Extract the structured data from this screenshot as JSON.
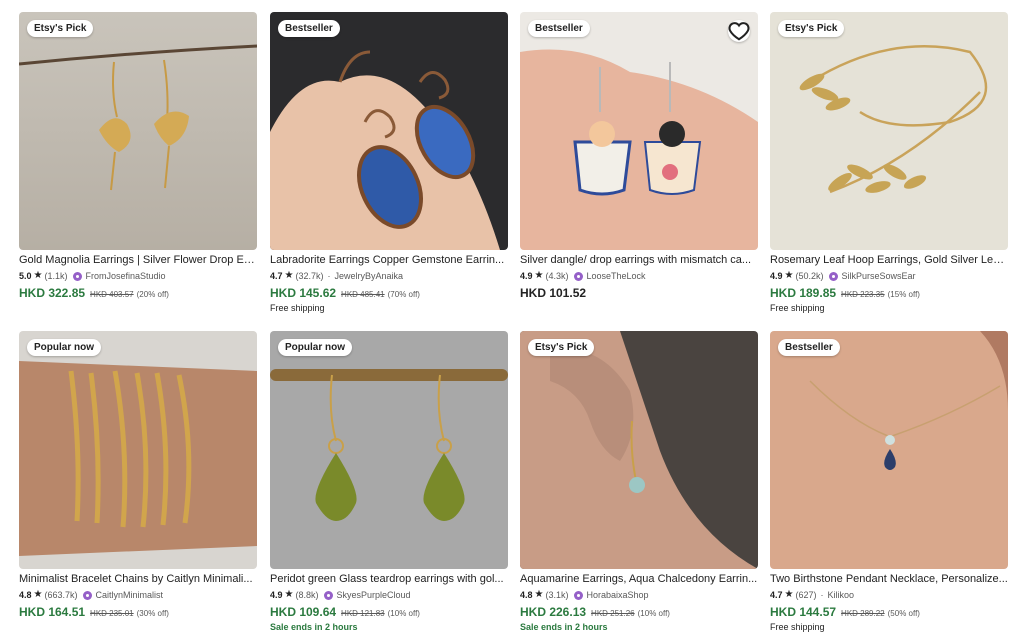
{
  "listings": [
    {
      "badge": "Etsy's Pick",
      "title": "Gold Magnolia Earrings | Silver Flower Drop Ea...",
      "rating": "5.0",
      "reviews": "(1.1k)",
      "shop": "FromJosefinaStudio",
      "price": "HKD 322.85",
      "original_price": "HKD 403.57",
      "discount": "(20% off)",
      "extra": ""
    },
    {
      "badge": "Bestseller",
      "title": "Labradorite Earrings Copper Gemstone Earrin...",
      "rating": "4.7",
      "reviews": "(32.7k)",
      "shop": "JewelryByAnaika",
      "price": "HKD 145.62",
      "original_price": "HKD 485.41",
      "discount": "(70% off)",
      "extra": "Free shipping"
    },
    {
      "badge": "Bestseller",
      "title": "Silver dangle/ drop earrings with mismatch ca...",
      "rating": "4.9",
      "reviews": "(4.3k)",
      "shop": "LooseTheLock",
      "price": "HKD 101.52",
      "original_price": "",
      "discount": "",
      "extra": ""
    },
    {
      "badge": "Etsy's Pick",
      "title": "Rosemary Leaf Hoop Earrings, Gold Silver Lea...",
      "rating": "4.9",
      "reviews": "(50.2k)",
      "shop": "SilkPurseSowsEar",
      "price": "HKD 189.85",
      "original_price": "HKD 223.35",
      "discount": "(15% off)",
      "extra": "Free shipping"
    },
    {
      "badge": "Popular now",
      "title": "Minimalist Bracelet Chains by Caitlyn Minimali...",
      "rating": "4.8",
      "reviews": "(663.7k)",
      "shop": "CaitlynMinimalist",
      "price": "HKD 164.51",
      "original_price": "HKD 235.01",
      "discount": "(30% off)",
      "extra": ""
    },
    {
      "badge": "Popular now",
      "title": "Peridot green Glass teardrop earrings with gol...",
      "rating": "4.9",
      "reviews": "(8.8k)",
      "shop": "SkyesPurpleCloud",
      "price": "HKD 109.64",
      "original_price": "HKD 121.83",
      "discount": "(10% off)",
      "extra": "Sale ends in 2 hours"
    },
    {
      "badge": "Etsy's Pick",
      "title": "Aquamarine Earrings, Aqua Chalcedony Earrin...",
      "rating": "4.8",
      "reviews": "(3.1k)",
      "shop": "HorabaixaShop",
      "price": "HKD 226.13",
      "original_price": "HKD 251.26",
      "discount": "(10% off)",
      "extra": "Sale ends in 2 hours"
    },
    {
      "badge": "Bestseller",
      "title": "Two Birthstone Pendant Necklace, Personalize...",
      "rating": "4.7",
      "reviews": "(627)",
      "shop": "Kilikoo",
      "price": "HKD 144.57",
      "original_price": "HKD 289.22",
      "discount": "(50% off)",
      "extra": "Free shipping"
    }
  ],
  "icons": {
    "rating": "star-icon",
    "shop": "shop-avatar-icon",
    "favorite": "heart-icon"
  },
  "colors": {
    "sale_price": "#2b7a3f",
    "text": "#222222",
    "muted": "#595959",
    "shop_icon": "#9560c8"
  }
}
